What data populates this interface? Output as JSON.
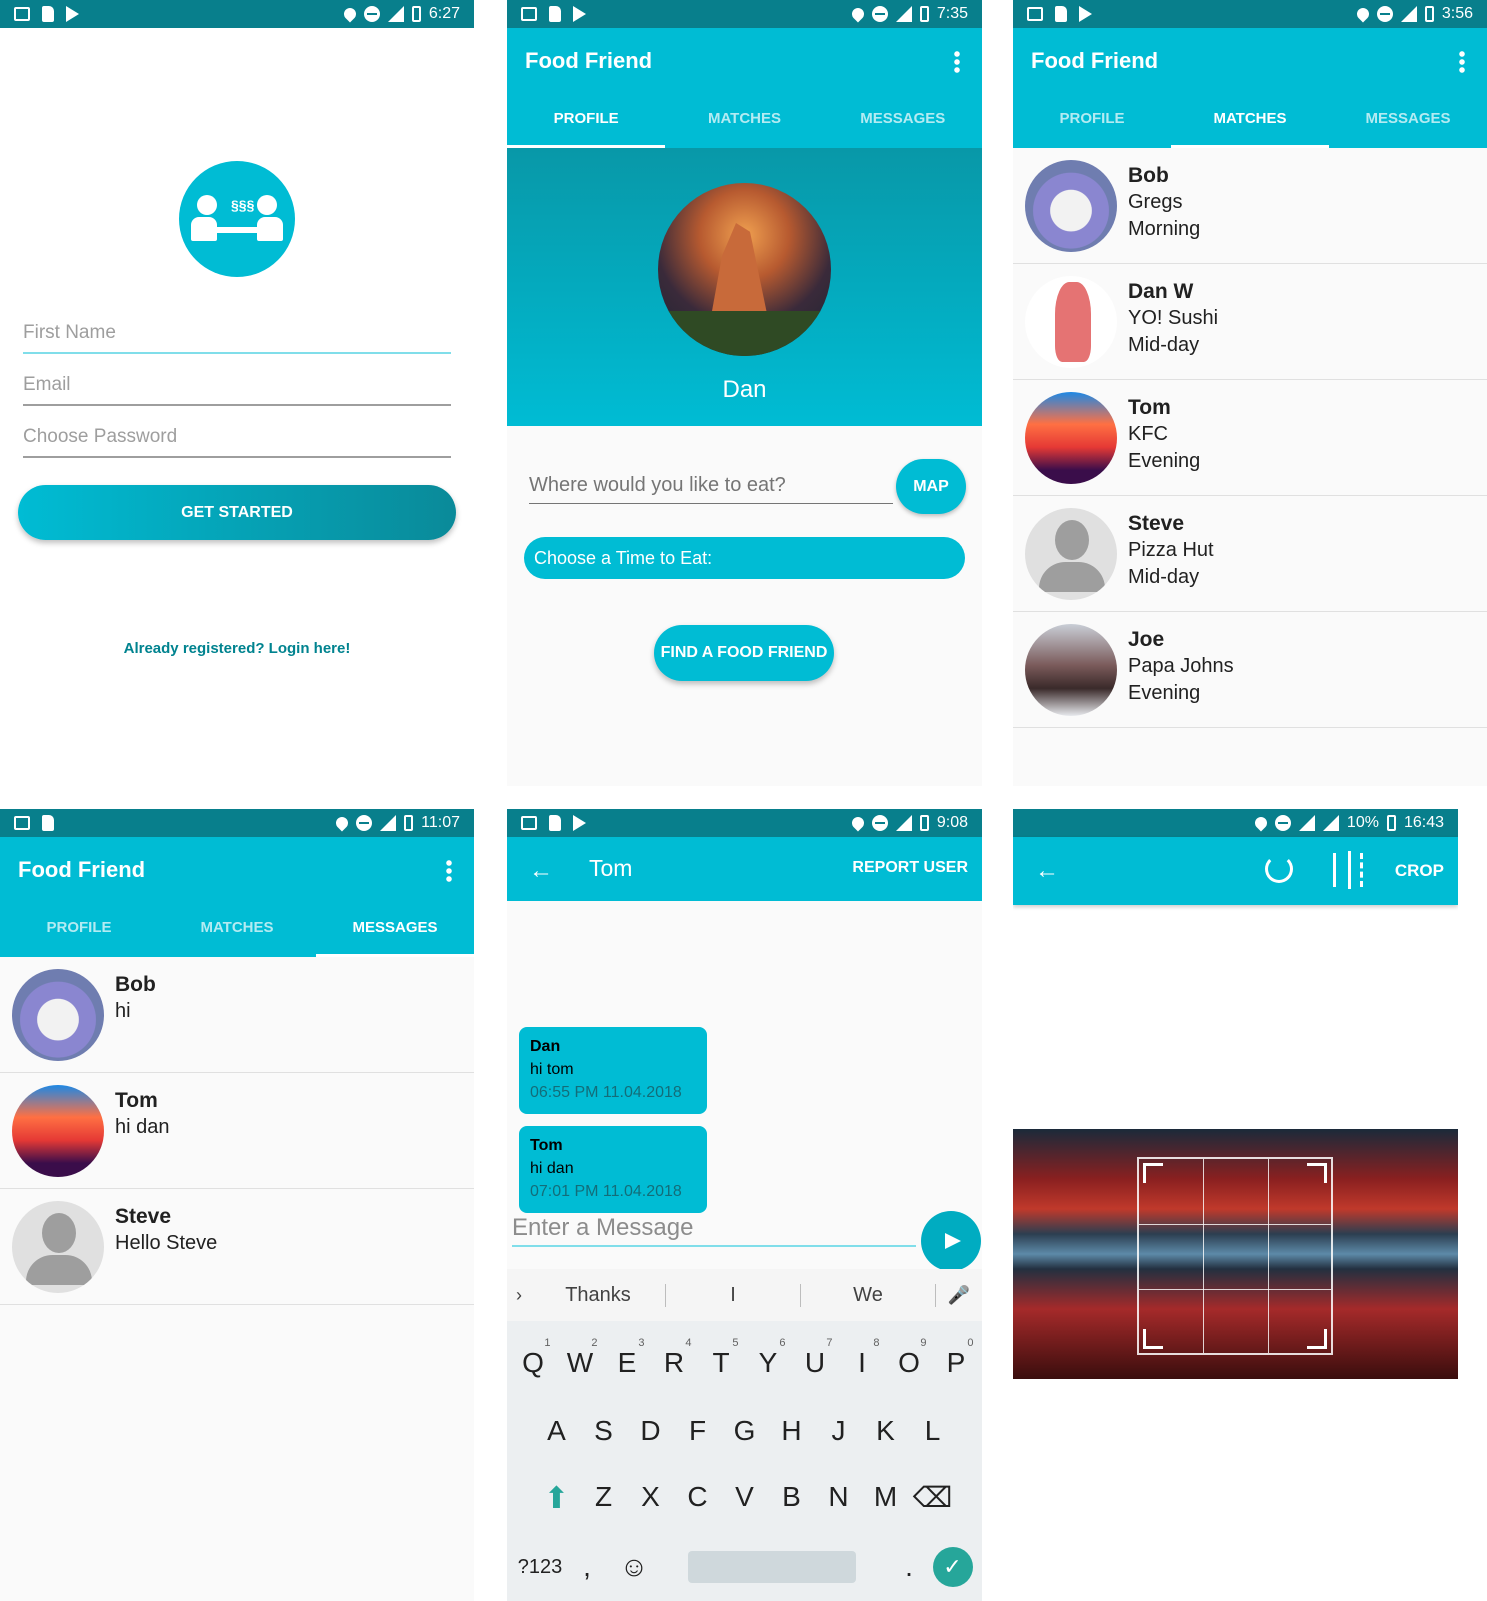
{
  "status_icons": {
    "left": [
      "mail-icon",
      "sd-card-icon",
      "play-store-icon"
    ],
    "right": [
      "location-icon",
      "dnd-icon",
      "lte-signal-icon",
      "battery-icon"
    ]
  },
  "colors": {
    "primary": "#00bcd4",
    "primary_dark": "#087f8c",
    "accent": "#26a69a"
  },
  "screen1": {
    "time": "6:27",
    "fields": [
      "First Name",
      "Email",
      "Choose Password"
    ],
    "get_started": "GET STARTED",
    "login_link": "Already registered? Login here!"
  },
  "screen2": {
    "time": "7:35",
    "title": "Food Friend",
    "tabs": [
      "PROFILE",
      "MATCHES",
      "MESSAGES"
    ],
    "profile_name": "Dan",
    "where_placeholder": "Where would you like to eat?",
    "map_button": "MAP",
    "time_button": "Choose a Time to Eat:",
    "find_button": "FIND A FOOD FRIEND"
  },
  "screen3": {
    "time": "3:56",
    "title": "Food Friend",
    "tabs": [
      "PROFILE",
      "MATCHES",
      "MESSAGES"
    ],
    "matches": [
      {
        "name": "Bob",
        "place": "Gregs",
        "time": "Morning"
      },
      {
        "name": "Dan W",
        "place": "YO! Sushi",
        "time": "Mid-day"
      },
      {
        "name": "Tom",
        "place": "KFC",
        "time": "Evening"
      },
      {
        "name": "Steve",
        "place": "Pizza Hut",
        "time": "Mid-day"
      },
      {
        "name": "Joe",
        "place": "Papa Johns",
        "time": "Evening"
      }
    ]
  },
  "screen4": {
    "time": "11:07",
    "title": "Food Friend",
    "tabs": [
      "PROFILE",
      "MATCHES",
      "MESSAGES"
    ],
    "messages": [
      {
        "name": "Bob",
        "last": "hi"
      },
      {
        "name": "Tom",
        "last": "hi dan"
      },
      {
        "name": "Steve",
        "last": "Hello Steve"
      }
    ]
  },
  "screen5": {
    "time": "9:08",
    "title": "Tom",
    "report": "REPORT USER",
    "bubbles": [
      {
        "name": "Dan",
        "text": "hi tom",
        "time": "06:55 PM 11.04.2018"
      },
      {
        "name": "Tom",
        "text": "hi dan",
        "time": "07:01 PM 11.04.2018"
      }
    ],
    "input_placeholder": "Enter a Message",
    "suggestions": [
      "Thanks",
      "I",
      "We"
    ],
    "row1": [
      "Q",
      "W",
      "E",
      "R",
      "T",
      "Y",
      "U",
      "I",
      "O",
      "P"
    ],
    "row1_nums": [
      "1",
      "2",
      "3",
      "4",
      "5",
      "6",
      "7",
      "8",
      "9",
      "0"
    ],
    "row2": [
      "A",
      "S",
      "D",
      "F",
      "G",
      "H",
      "J",
      "K",
      "L"
    ],
    "row3": [
      "Z",
      "X",
      "C",
      "V",
      "B",
      "N",
      "M"
    ],
    "sym_key": "?123",
    "comma": ",",
    "period": "."
  },
  "screen6": {
    "status_text": "10%",
    "time": "16:43",
    "crop_label": "CROP"
  }
}
